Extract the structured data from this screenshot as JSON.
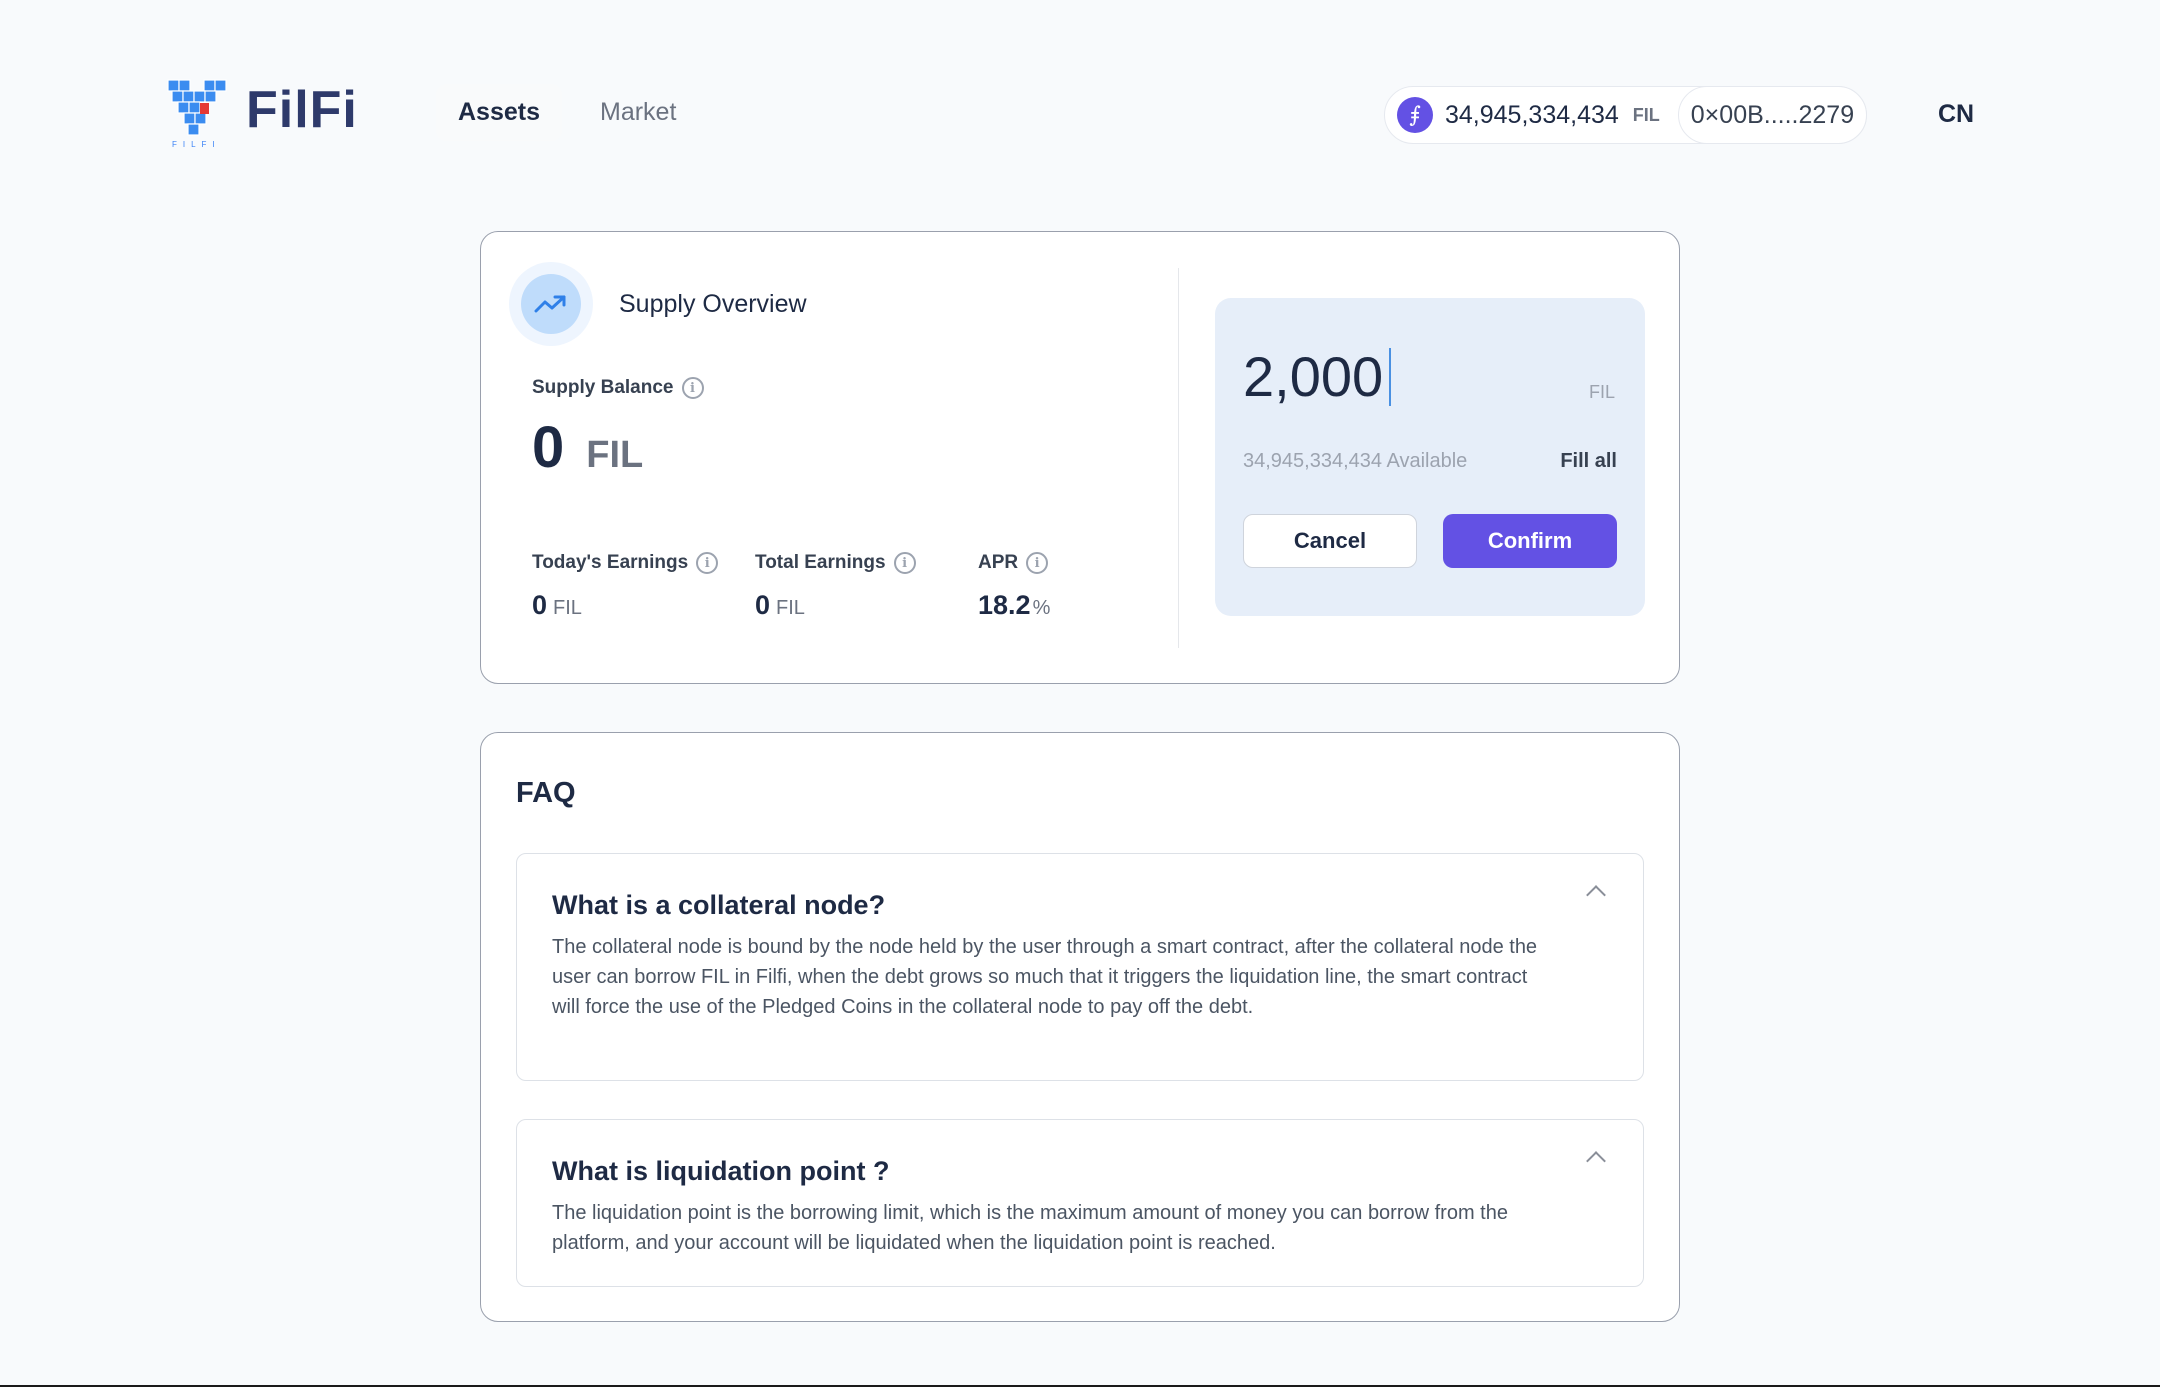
{
  "brand": {
    "name": "FilFi",
    "subtitle": "FILFI"
  },
  "nav": {
    "tabs": [
      {
        "label": "Assets",
        "active": true
      },
      {
        "label": "Market",
        "active": false
      }
    ]
  },
  "wallet": {
    "coin_icon": "filecoin-icon",
    "coin_glyph": "⨎",
    "balance": "34,945,334,434",
    "unit": "FIL",
    "address": "0×00B.....2279"
  },
  "language": {
    "label": "CN"
  },
  "supply_overview": {
    "title": "Supply Overview",
    "icon": "trending-up-icon",
    "balance": {
      "label": "Supply Balance",
      "value": "0",
      "unit": "FIL"
    },
    "stats": [
      {
        "label": "Today's Earnings",
        "value": "0",
        "unit": "FIL"
      },
      {
        "label": "Total Earnings",
        "value": "0",
        "unit": "FIL"
      },
      {
        "label": "APR",
        "value": "18.2",
        "unit": "%"
      }
    ],
    "info_glyph": "i"
  },
  "supply_form": {
    "amount": "2,000",
    "unit": "FIL",
    "available": "34,945,334,434 Available",
    "fill_all": "Fill all",
    "cancel": "Cancel",
    "confirm": "Confirm"
  },
  "faq": {
    "title": "FAQ",
    "items": [
      {
        "question": "What is a collateral node?",
        "answer": "The collateral node is bound by the node held by the user through a smart contract, after the collateral node the user can borrow FIL in Filfi, when the debt grows so much that it triggers the liquidation line, the smart contract will force the use of the Pledged Coins in the collateral node to pay off the debt.",
        "expanded": true
      },
      {
        "question": "What is liquidation point ?",
        "answer": "The liquidation point is the borrowing limit, which is the maximum amount of money you can borrow from the platform, and your account will be liquidated when the liquidation point is reached.",
        "expanded": true
      }
    ]
  },
  "colors": {
    "accent": "#6351e4",
    "text_dark": "#1e2a44",
    "panel_bg": "#e6eef9",
    "icon_blue": "#3b82f6",
    "logo_red": "#e53935"
  }
}
